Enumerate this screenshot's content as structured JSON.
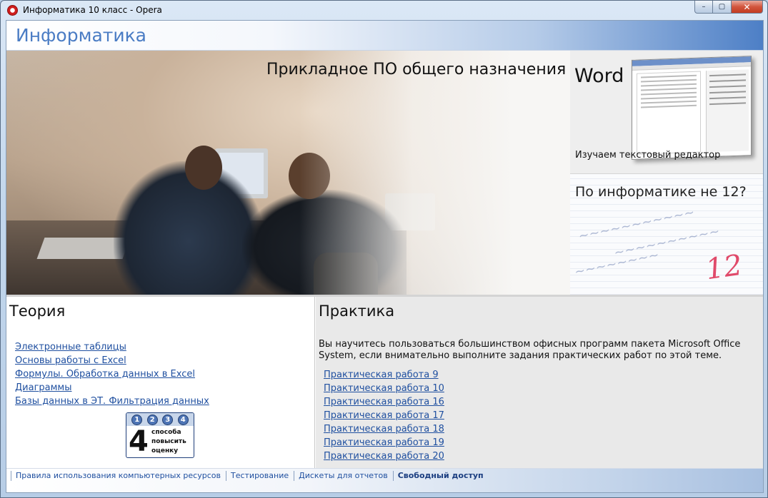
{
  "window": {
    "title": "Информатика 10 класс - Opera",
    "buttons": {
      "minimize": "–",
      "maximize": "▢",
      "close": "✕"
    }
  },
  "header": {
    "site_title": "Информатика"
  },
  "banner": {
    "heading": "Прикладное ПО общего назначения"
  },
  "promo": {
    "word": {
      "label": "Word",
      "caption": "Изучаем текстовый редактор"
    },
    "grade": {
      "title": "По информатике не 12?"
    }
  },
  "theory": {
    "title": "Теория",
    "links": [
      "Электронные таблицы",
      "Основы работы с Excel",
      "Формулы. Обработка данных в Excel",
      "Диаграммы",
      "Базы данных в ЭТ. Фильтрация данных"
    ],
    "badge": {
      "dots": [
        "1",
        "2",
        "3",
        "4"
      ],
      "number": "4",
      "line1": "способа",
      "line2": "повысить",
      "line3": "оценку"
    }
  },
  "practice": {
    "title": "Практика",
    "description": "Вы научитесь пользоваться большинством офисных программ пакета Microsoft Office System, если внимательно выполните задания практических работ по этой теме.",
    "links": [
      "Практическая работа 9",
      "Практическая работа 10",
      "Практическая работа 16",
      "Практическая работа 17",
      "Практическая работа 18",
      "Практическая работа 19",
      "Практическая работа 20"
    ]
  },
  "footer": {
    "links": [
      "Правила использования компьютерных ресурсов",
      "Тестирование",
      "Дискеты для отчетов",
      "Свободный доступ"
    ]
  },
  "colors": {
    "accent": "#4a7cc4",
    "link": "#2050a0",
    "close_button": "#c23b22"
  }
}
